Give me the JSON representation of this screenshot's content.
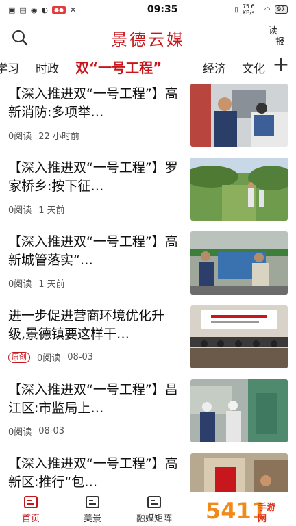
{
  "status_bar": {
    "time": "09:35",
    "net_speed": "75.6 KB/s",
    "battery": "97"
  },
  "header": {
    "title": "景德云媒",
    "read_label_1": "读",
    "read_label_2": "报"
  },
  "tabs": [
    {
      "label": "学习"
    },
    {
      "label": "时政"
    },
    {
      "label": "双“一号工程”"
    },
    {
      "label": "经济"
    },
    {
      "label": "文化"
    }
  ],
  "news": [
    {
      "title": "【深入推进双“一号工程”】高新消防:多项举…",
      "reads": "0阅读",
      "time": "22 小时前",
      "badge": ""
    },
    {
      "title": "【深入推进双“一号工程”】罗家桥乡:按下征…",
      "reads": "0阅读",
      "time": "1 天前",
      "badge": ""
    },
    {
      "title": "【深入推进双“一号工程”】高新城管落实“…",
      "reads": "0阅读",
      "time": "1 天前",
      "badge": ""
    },
    {
      "title": "进一步促进营商环境优化升级,景德镇要这样干…",
      "reads": "0阅读",
      "time": "08-03",
      "badge": "原创"
    },
    {
      "title": "【深入推进双“一号工程”】昌江区:市监局上…",
      "reads": "0阅读",
      "time": "08-03",
      "badge": ""
    },
    {
      "title": "【深入推进双“一号工程”】高新区:推行“包…",
      "reads": "",
      "time": "",
      "badge": ""
    }
  ],
  "bottom_nav": [
    {
      "label": "首页"
    },
    {
      "label": "美景"
    },
    {
      "label": "融媒矩阵"
    }
  ],
  "watermark": "54119 手游网",
  "colors": {
    "brand": "#c8171c"
  }
}
